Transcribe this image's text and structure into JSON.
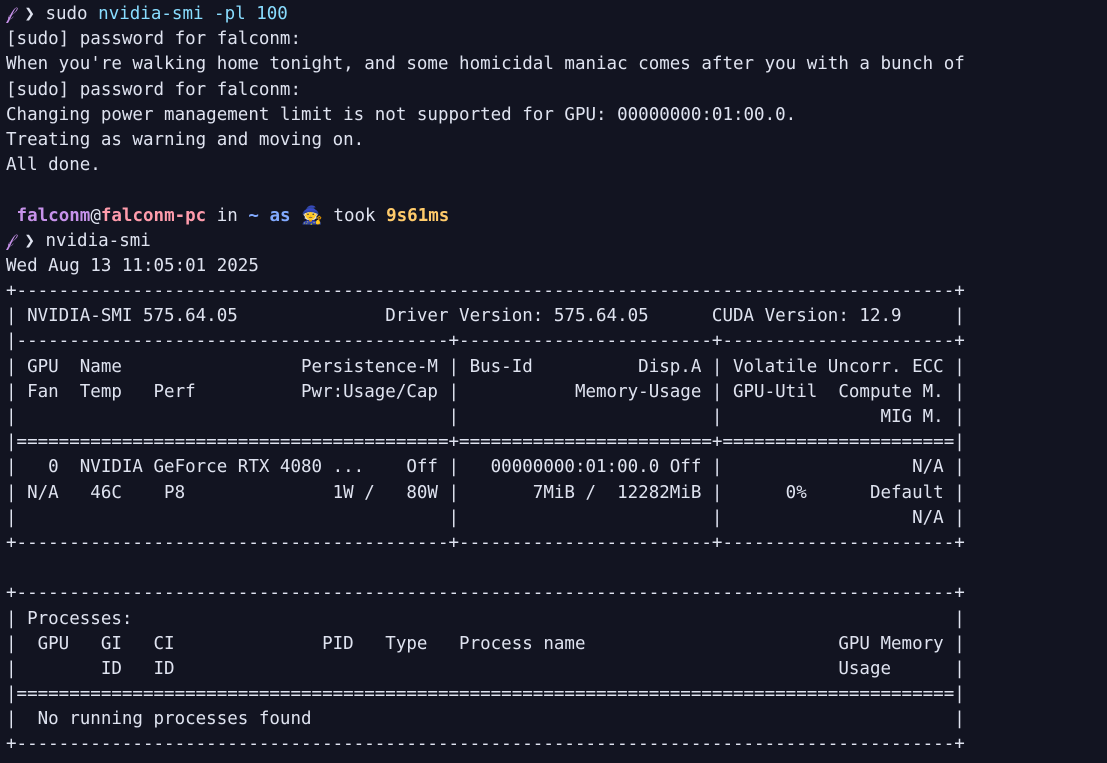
{
  "prompt": {
    "symbol": "𝒻",
    "arrow": "❯",
    "user": "falconm",
    "at": "@",
    "host": "falconm-pc",
    "in": " in ",
    "dir": "~",
    "as": " as ",
    "wizard": "🧙",
    "took": " took ",
    "duration": "9s61ms"
  },
  "command1": {
    "name": "sudo",
    "args": "nvidia-smi -pl 100"
  },
  "output1": [
    "[sudo] password for falconm:",
    "When you're walking home tonight, and some homicidal maniac comes after you with a bunch of",
    "[sudo] password for falconm:",
    "Changing power management limit is not supported for GPU: 00000000:01:00.0.",
    "Treating as warning and moving on.",
    "All done."
  ],
  "command2": {
    "name": "nvidia-smi"
  },
  "output2": [
    "Wed Aug 13 11:05:01 2025",
    "+-----------------------------------------------------------------------------------------+",
    "| NVIDIA-SMI 575.64.05              Driver Version: 575.64.05      CUDA Version: 12.9     |",
    "|-----------------------------------------+------------------------+----------------------+",
    "| GPU  Name                 Persistence-M | Bus-Id          Disp.A | Volatile Uncorr. ECC |",
    "| Fan  Temp   Perf          Pwr:Usage/Cap |           Memory-Usage | GPU-Util  Compute M. |",
    "|                                         |                        |               MIG M. |",
    "|=========================================+========================+======================|",
    "|   0  NVIDIA GeForce RTX 4080 ...    Off |   00000000:01:00.0 Off |                  N/A |",
    "| N/A   46C    P8              1W /   80W |       7MiB /  12282MiB |      0%      Default |",
    "|                                         |                        |                  N/A |",
    "+-----------------------------------------+------------------------+----------------------+",
    "",
    "+-----------------------------------------------------------------------------------------+",
    "| Processes:                                                                              |",
    "|  GPU   GI   CI              PID   Type   Process name                        GPU Memory |",
    "|        ID   ID                                                               Usage      |",
    "|=========================================================================================|",
    "|  No running processes found                                                             |",
    "+-----------------------------------------------------------------------------------------+"
  ]
}
